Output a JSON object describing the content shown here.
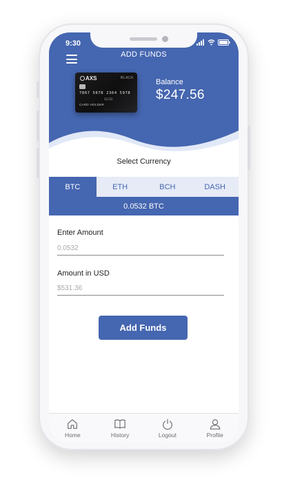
{
  "status_bar": {
    "time": "9:30"
  },
  "header": {
    "title": "ADD FUNDS"
  },
  "card": {
    "brand": "AXS",
    "tier": "BLACK",
    "number": "7867 5678 2364 5978",
    "expiry": "12/13",
    "holder": "CARD HOLDER"
  },
  "balance": {
    "label": "Balance",
    "value": "$247.56"
  },
  "currency": {
    "label": "Select Currency",
    "tabs": [
      {
        "label": "BTC",
        "active": true
      },
      {
        "label": "ETH"
      },
      {
        "label": "BCH"
      },
      {
        "label": "DASH"
      }
    ],
    "rate_display": "0.0532 BTC"
  },
  "form": {
    "amount_label": "Enter Amount",
    "amount_placeholder": "0.0532",
    "usd_label": "Amount in USD",
    "usd_placeholder": "$531.36",
    "submit_label": "Add Funds"
  },
  "nav": {
    "items": [
      {
        "label": "Home",
        "icon": "home-icon"
      },
      {
        "label": "History",
        "icon": "book-icon"
      },
      {
        "label": "Logout",
        "icon": "power-icon"
      },
      {
        "label": "Profile",
        "icon": "user-icon"
      }
    ]
  },
  "colors": {
    "primary": "#4566b0",
    "tab_bg": "#e6ebf6",
    "wave": "#e1e8f7"
  }
}
